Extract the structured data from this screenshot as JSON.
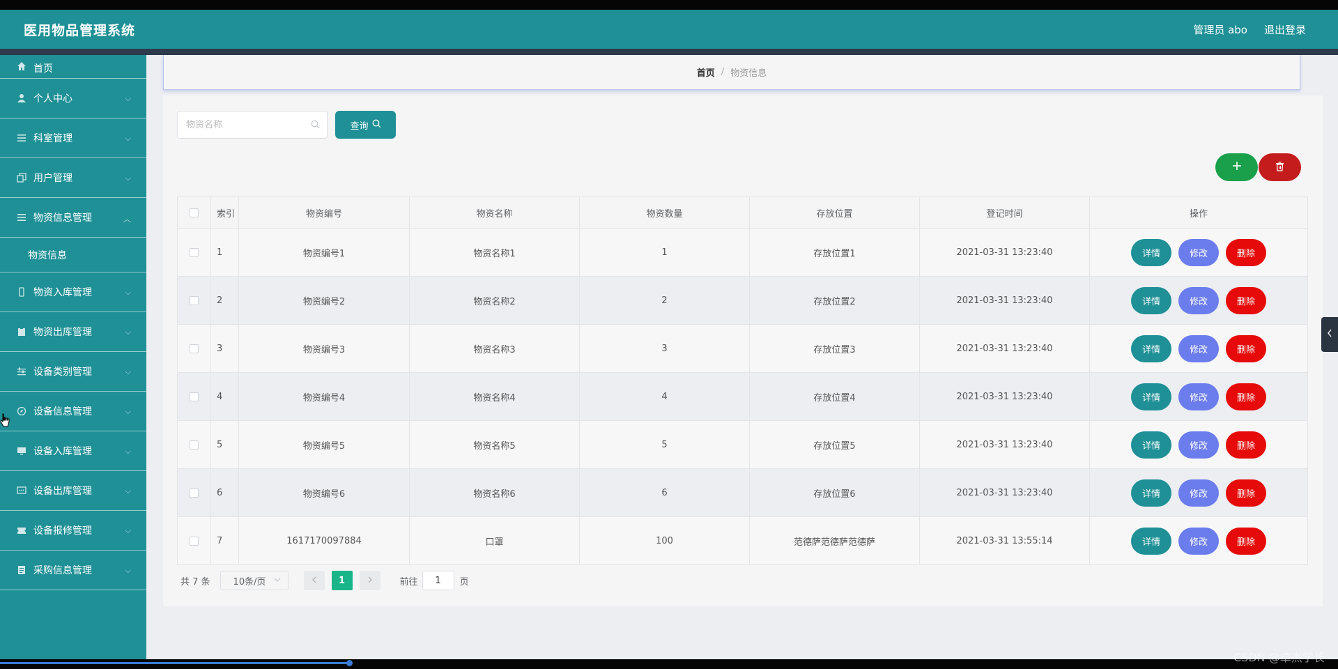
{
  "app": {
    "title": "医用物品管理系统",
    "user_label": "管理员 abo",
    "logout_label": "退出登录"
  },
  "sidebar": {
    "items": [
      {
        "label": "首页",
        "icon": "home-icon"
      },
      {
        "label": "个人中心",
        "icon": "user-icon"
      },
      {
        "label": "科室管理",
        "icon": "menu-icon"
      },
      {
        "label": "用户管理",
        "icon": "copy-icon"
      },
      {
        "label": "物资信息管理",
        "icon": "menu-icon",
        "expanded": true,
        "children": [
          {
            "label": "物资信息"
          }
        ]
      },
      {
        "label": "物资入库管理",
        "icon": "mobile-icon"
      },
      {
        "label": "物资出库管理",
        "icon": "clipboard-icon"
      },
      {
        "label": "设备类别管理",
        "icon": "sliders-icon"
      },
      {
        "label": "设备信息管理",
        "icon": "compass-icon"
      },
      {
        "label": "设备入库管理",
        "icon": "monitor-icon"
      },
      {
        "label": "设备出库管理",
        "icon": "chat-icon"
      },
      {
        "label": "设备报修管理",
        "icon": "ticket-icon"
      },
      {
        "label": "采购信息管理",
        "icon": "document-icon"
      }
    ]
  },
  "breadcrumb": {
    "home": "首页",
    "separator": "/",
    "current": "物资信息"
  },
  "search": {
    "placeholder": "物资名称",
    "value": "",
    "query_label": "查询"
  },
  "table": {
    "headers": [
      "索引",
      "物资编号",
      "物资名称",
      "物资数量",
      "存放位置",
      "登记时间",
      "操作"
    ],
    "rows": [
      {
        "index": "1",
        "code": "物资编号1",
        "name": "物资名称1",
        "qty": "1",
        "location": "存放位置1",
        "time": "2021-03-31 13:23:40"
      },
      {
        "index": "2",
        "code": "物资编号2",
        "name": "物资名称2",
        "qty": "2",
        "location": "存放位置2",
        "time": "2021-03-31 13:23:40"
      },
      {
        "index": "3",
        "code": "物资编号3",
        "name": "物资名称3",
        "qty": "3",
        "location": "存放位置3",
        "time": "2021-03-31 13:23:40"
      },
      {
        "index": "4",
        "code": "物资编号4",
        "name": "物资名称4",
        "qty": "4",
        "location": "存放位置4",
        "time": "2021-03-31 13:23:40"
      },
      {
        "index": "5",
        "code": "物资编号5",
        "name": "物资名称5",
        "qty": "5",
        "location": "存放位置5",
        "time": "2021-03-31 13:23:40"
      },
      {
        "index": "6",
        "code": "物资编号6",
        "name": "物资名称6",
        "qty": "6",
        "location": "存放位置6",
        "time": "2021-03-31 13:23:40"
      },
      {
        "index": "7",
        "code": "1617170097884",
        "name": "口罩",
        "qty": "100",
        "location": "范德萨范德萨范德萨",
        "time": "2021-03-31 13:55:14"
      }
    ],
    "actions": {
      "detail": "详情",
      "edit": "修改",
      "delete": "删除"
    }
  },
  "pagination": {
    "total": "共 7 条",
    "page_size": "10条/页",
    "current_page": "1",
    "goto_prefix": "前往",
    "goto_value": "1",
    "goto_suffix": "页"
  },
  "watermark": "CSDN @卓杰学长",
  "colors": {
    "primary": "#1e9096",
    "add": "#1aa04a",
    "danger": "#e60a0a",
    "edit": "#6b7ced",
    "pager_active": "#19b589"
  }
}
